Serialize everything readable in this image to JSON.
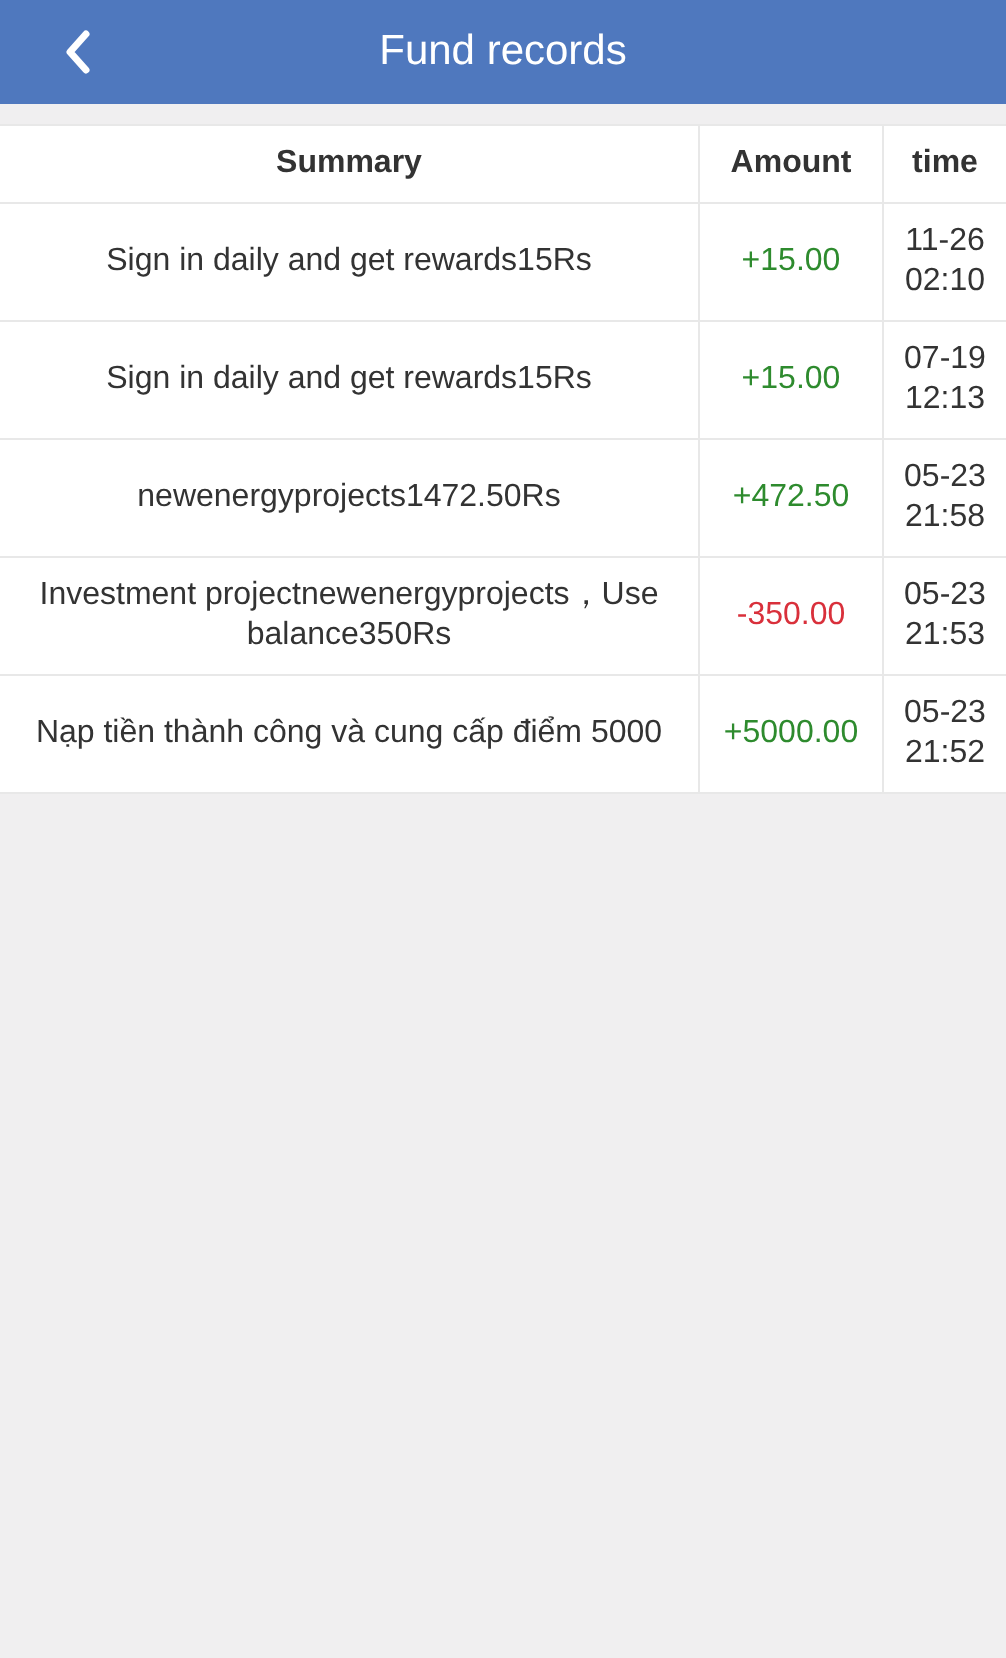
{
  "header": {
    "title": "Fund records"
  },
  "table": {
    "columns": [
      "Summary",
      "Amount",
      "time"
    ],
    "rows": [
      {
        "summary": "Sign in daily and get rewards15Rs",
        "amount": "+15.00",
        "color": "#2e8b2e",
        "time": "11-26 02:10"
      },
      {
        "summary": "Sign in daily and get rewards15Rs",
        "amount": "+15.00",
        "color": "#2e8b2e",
        "time": "07-19 12:13"
      },
      {
        "summary": "newenergyprojects1472.50Rs",
        "amount": "+472.50",
        "color": "#2e8b2e",
        "time": "05-23 21:58"
      },
      {
        "summary": "Investment projectnewenergyprojects，Use balance350Rs",
        "amount": "-350.00",
        "color": "#d9303b",
        "time": "05-23 21:53"
      },
      {
        "summary": "Nạp tiền thành công và cung cấp điểm 5000",
        "amount": "+5000.00",
        "color": "#2e8b2e",
        "time": "05-23 21:52"
      }
    ]
  }
}
